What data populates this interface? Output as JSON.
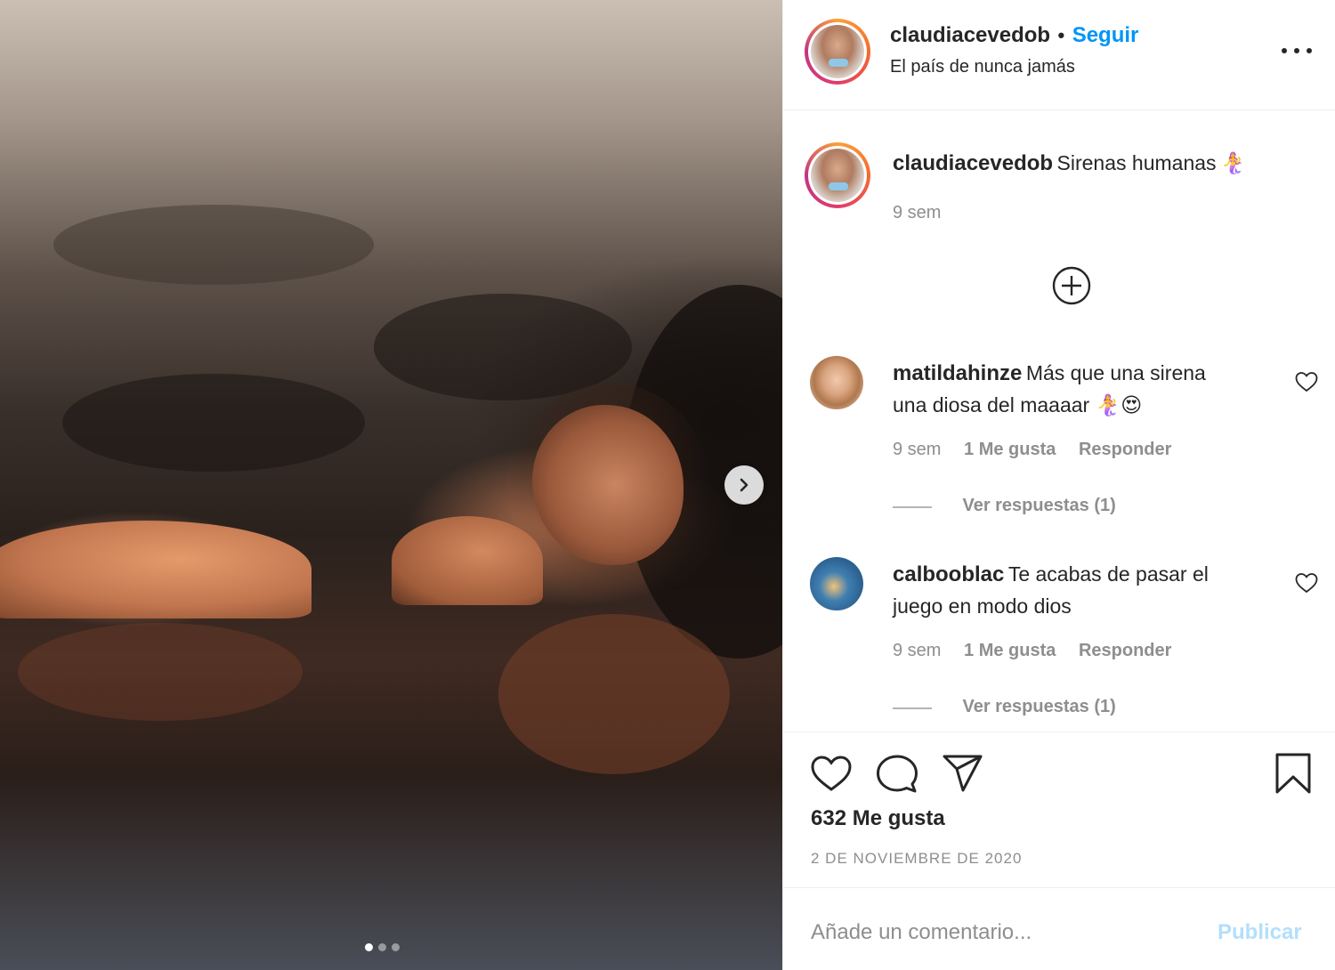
{
  "post": {
    "username": "claudiacevedob",
    "follow_label": "Seguir",
    "separator": "•",
    "location": "El país de nunca jamás",
    "caption": "Sirenas humanas",
    "caption_emoji": "🧜‍♀️",
    "caption_time": "9 sem",
    "carousel": {
      "current_slide": 1,
      "total_slides": 3
    }
  },
  "comments": [
    {
      "username": "matildahinze",
      "text_line1": "Más que una sirena",
      "text_line2": "una diosa del maaaar 🧜‍♀️😍",
      "time": "9 sem",
      "likes": "1 Me gusta",
      "reply_label": "Responder",
      "view_replies": "Ver respuestas (1)"
    },
    {
      "username": "calbooblac",
      "text_line1": "Te acabas de pasar el",
      "text_line2": "juego en modo dios",
      "time": "9 sem",
      "likes": "1 Me gusta",
      "reply_label": "Responder",
      "view_replies": "Ver respuestas (1)"
    }
  ],
  "stats": {
    "likes": "632 Me gusta",
    "date": "2 DE NOVIEMBRE DE 2020"
  },
  "composer": {
    "placeholder": "Añade un comentario...",
    "publish_label": "Publicar"
  },
  "colors": {
    "accent": "#0095f6",
    "publish_disabled": "#b2dffc",
    "muted": "#8e8e8e",
    "text": "#262626"
  },
  "icons": {
    "next": "chevron-right-icon",
    "more": "more-horizontal-icon",
    "add": "plus-circle-icon",
    "like": "heart-icon",
    "comment": "comment-bubble-icon",
    "share": "paper-plane-icon",
    "save": "bookmark-icon"
  }
}
